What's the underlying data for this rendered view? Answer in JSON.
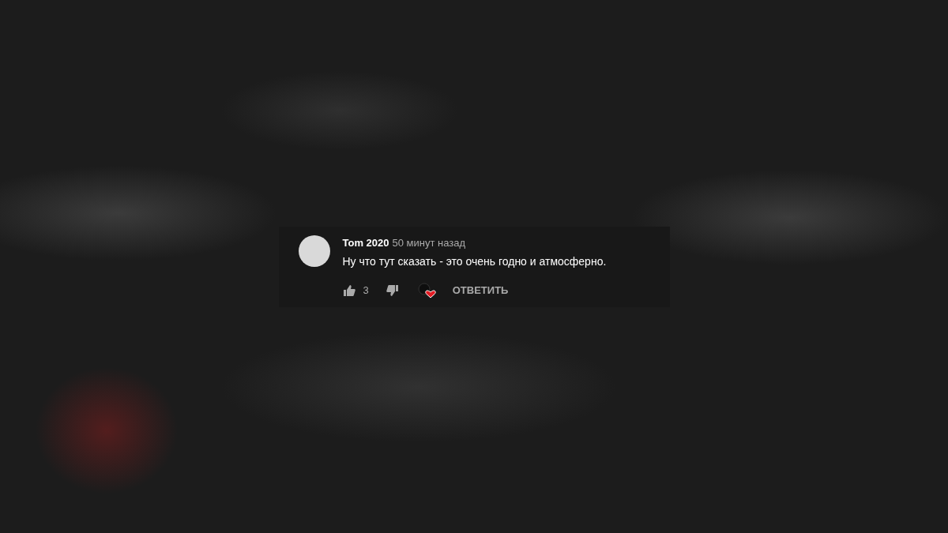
{
  "comment": {
    "author": "Tom 2020",
    "time": "50 минут назад",
    "text": "Ну что тут сказать - это очень годно и атмосферно.",
    "likes": "3",
    "hearted": true,
    "reply_label": "ОТВЕТИТЬ"
  }
}
